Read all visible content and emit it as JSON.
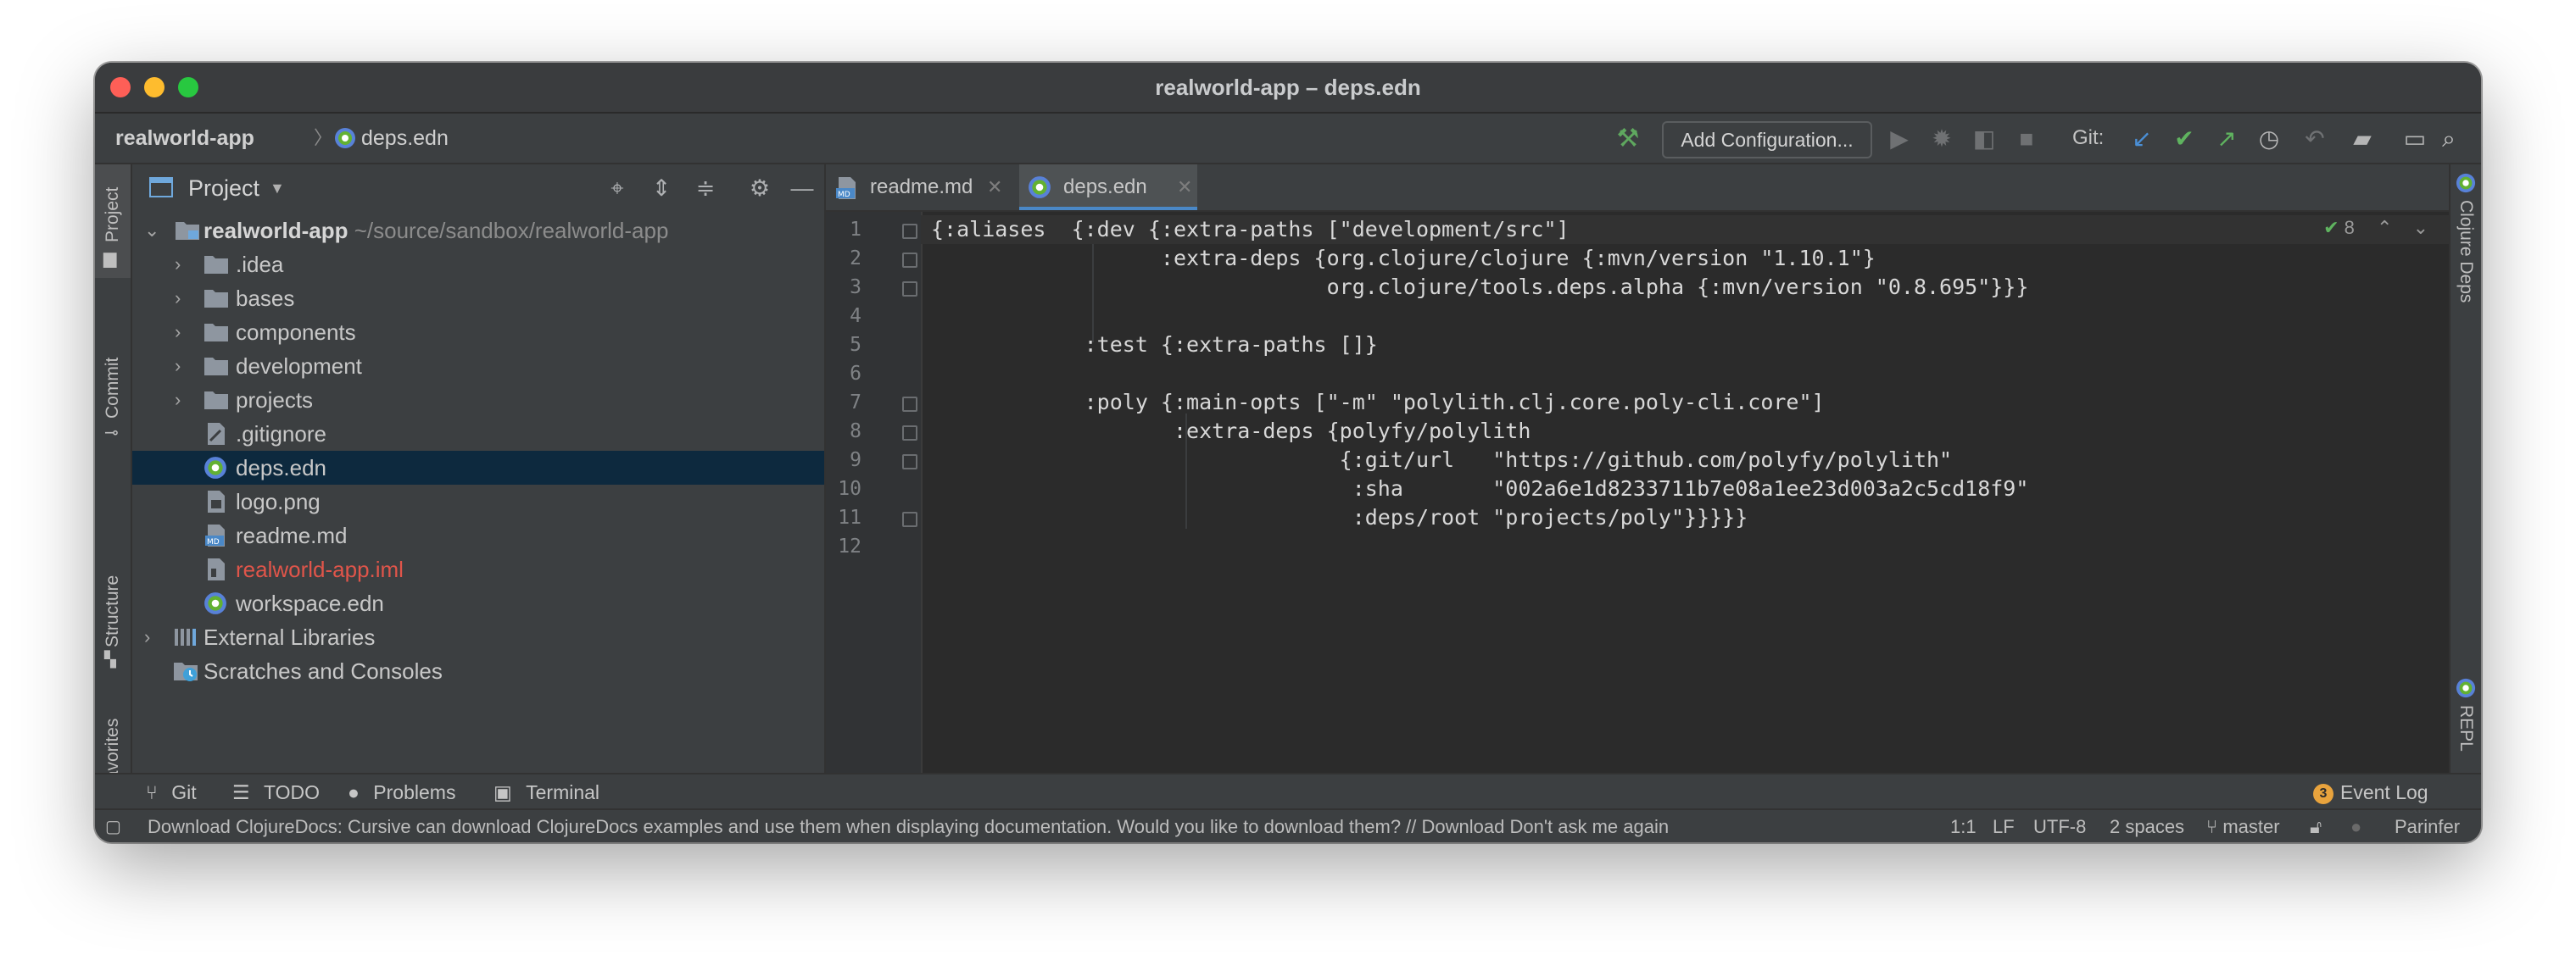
{
  "window": {
    "title": "realworld-app – deps.edn"
  },
  "navbar": {
    "project": "realworld-app",
    "file": "deps.edn",
    "add_configuration": "Add Configuration...",
    "git_label": "Git:"
  },
  "left_tools": {
    "project": "Project",
    "commit": "Commit",
    "structure": "Structure",
    "favorites": "Favorites"
  },
  "right_tools": {
    "clojure_deps": "Clojure Deps",
    "repl": "REPL"
  },
  "project_panel": {
    "title": "Project",
    "root_name": "realworld-app",
    "root_path": "~/source/sandbox/realworld-app",
    "items": [
      {
        "label": ".idea"
      },
      {
        "label": "bases"
      },
      {
        "label": "components"
      },
      {
        "label": "development"
      },
      {
        "label": "projects"
      },
      {
        "label": ".gitignore"
      },
      {
        "label": "deps.edn"
      },
      {
        "label": "logo.png"
      },
      {
        "label": "readme.md"
      },
      {
        "label": "realworld-app.iml"
      },
      {
        "label": "workspace.edn"
      }
    ],
    "external_libraries": "External Libraries",
    "scratches": "Scratches and Consoles"
  },
  "editor": {
    "tabs": [
      {
        "label": "readme.md"
      },
      {
        "label": "deps.edn"
      }
    ],
    "inspection_count": "8",
    "line_numbers": [
      "1",
      "2",
      "3",
      "4",
      "5",
      "6",
      "7",
      "8",
      "9",
      "10",
      "11",
      "12"
    ],
    "lines": [
      "{:aliases  {:dev {:extra-paths [\"development/src\"]",
      "                  :extra-deps {org.clojure/clojure {:mvn/version \"1.10.1\"}",
      "                               org.clojure/tools.deps.alpha {:mvn/version \"0.8.695\"}}}",
      "",
      "            :test {:extra-paths []}",
      "",
      "            :poly {:main-opts [\"-m\" \"polylith.clj.core.poly-cli.core\"]",
      "                   :extra-deps {polyfy/polylith",
      "                                {:git/url   \"https://github.com/polyfy/polylith\"",
      "                                 :sha       \"002a6e1d8233711b7e08a1ee23d003a2c5cd18f9\"",
      "                                 :deps/root \"projects/poly\"}}}}}",
      ""
    ]
  },
  "bottom_tools": {
    "git": "Git",
    "todo": "TODO",
    "problems": "Problems",
    "terminal": "Terminal",
    "event_log_count": "3",
    "event_log": "Event Log"
  },
  "status": {
    "message": "Download ClojureDocs: Cursive can download ClojureDocs examples and use them when displaying documentation. Would you like to download them? // Download Don't ask me again",
    "position": "1:1",
    "line_sep": "LF",
    "encoding": "UTF-8",
    "indent": "2 spaces",
    "branch": "master",
    "mode": "Parinfer"
  }
}
